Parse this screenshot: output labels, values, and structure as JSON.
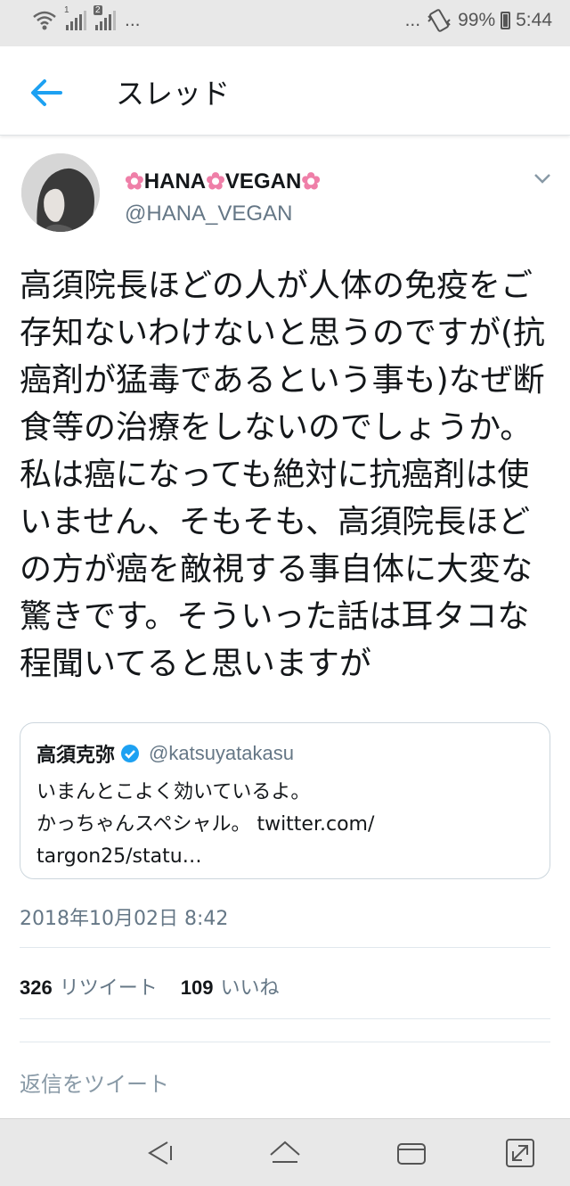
{
  "status_bar": {
    "sim1_label": "1",
    "sim2_label": "2",
    "left_ellipsis": "...",
    "right_ellipsis": "...",
    "battery_percent": "99%",
    "time": "5:44",
    "icons": [
      "wifi-icon",
      "signal-icon",
      "signal-icon",
      "vibrate-icon",
      "battery-icon"
    ]
  },
  "app_bar": {
    "title": "スレッド",
    "back_icon": "arrow-left-icon",
    "accent_color": "#1da1f2"
  },
  "tweet": {
    "display_name_parts": [
      "HANA",
      "VEGAN"
    ],
    "name_decoration_icon": "cherry-blossom-icon",
    "handle": "@HANA_VEGAN",
    "text": "高須院長ほどの人が人体の免疫をご存知ないわけないと思うのですが(抗癌剤が猛毒であるという事も)なぜ断食等の治療をしないのでしょうか。私は癌になっても絶対に抗癌剤は使いません、そもそも、高須院長ほどの方が癌を敵視する事自体に大変な驚きです。そういった話は耳タコな程聞いてると思いますが",
    "timestamp": "2018年10月02日 8:42",
    "retweets_count": "326",
    "retweets_label": "リツイート",
    "likes_count": "109",
    "likes_label": "いいね"
  },
  "quoted_tweet": {
    "name": "高須克弥",
    "verified": true,
    "handle": "@katsuyatakasu",
    "line1": "いまんとこよく効いているよ。",
    "line2": "かっちゃんスペシャル。 twitter.com/",
    "line3": "targon25/statu…"
  },
  "reply": {
    "placeholder": "返信をツイート"
  },
  "nav_bar": {
    "icons": [
      "back-triangle-icon",
      "home-icon",
      "recents-icon",
      "expand-icon"
    ]
  }
}
